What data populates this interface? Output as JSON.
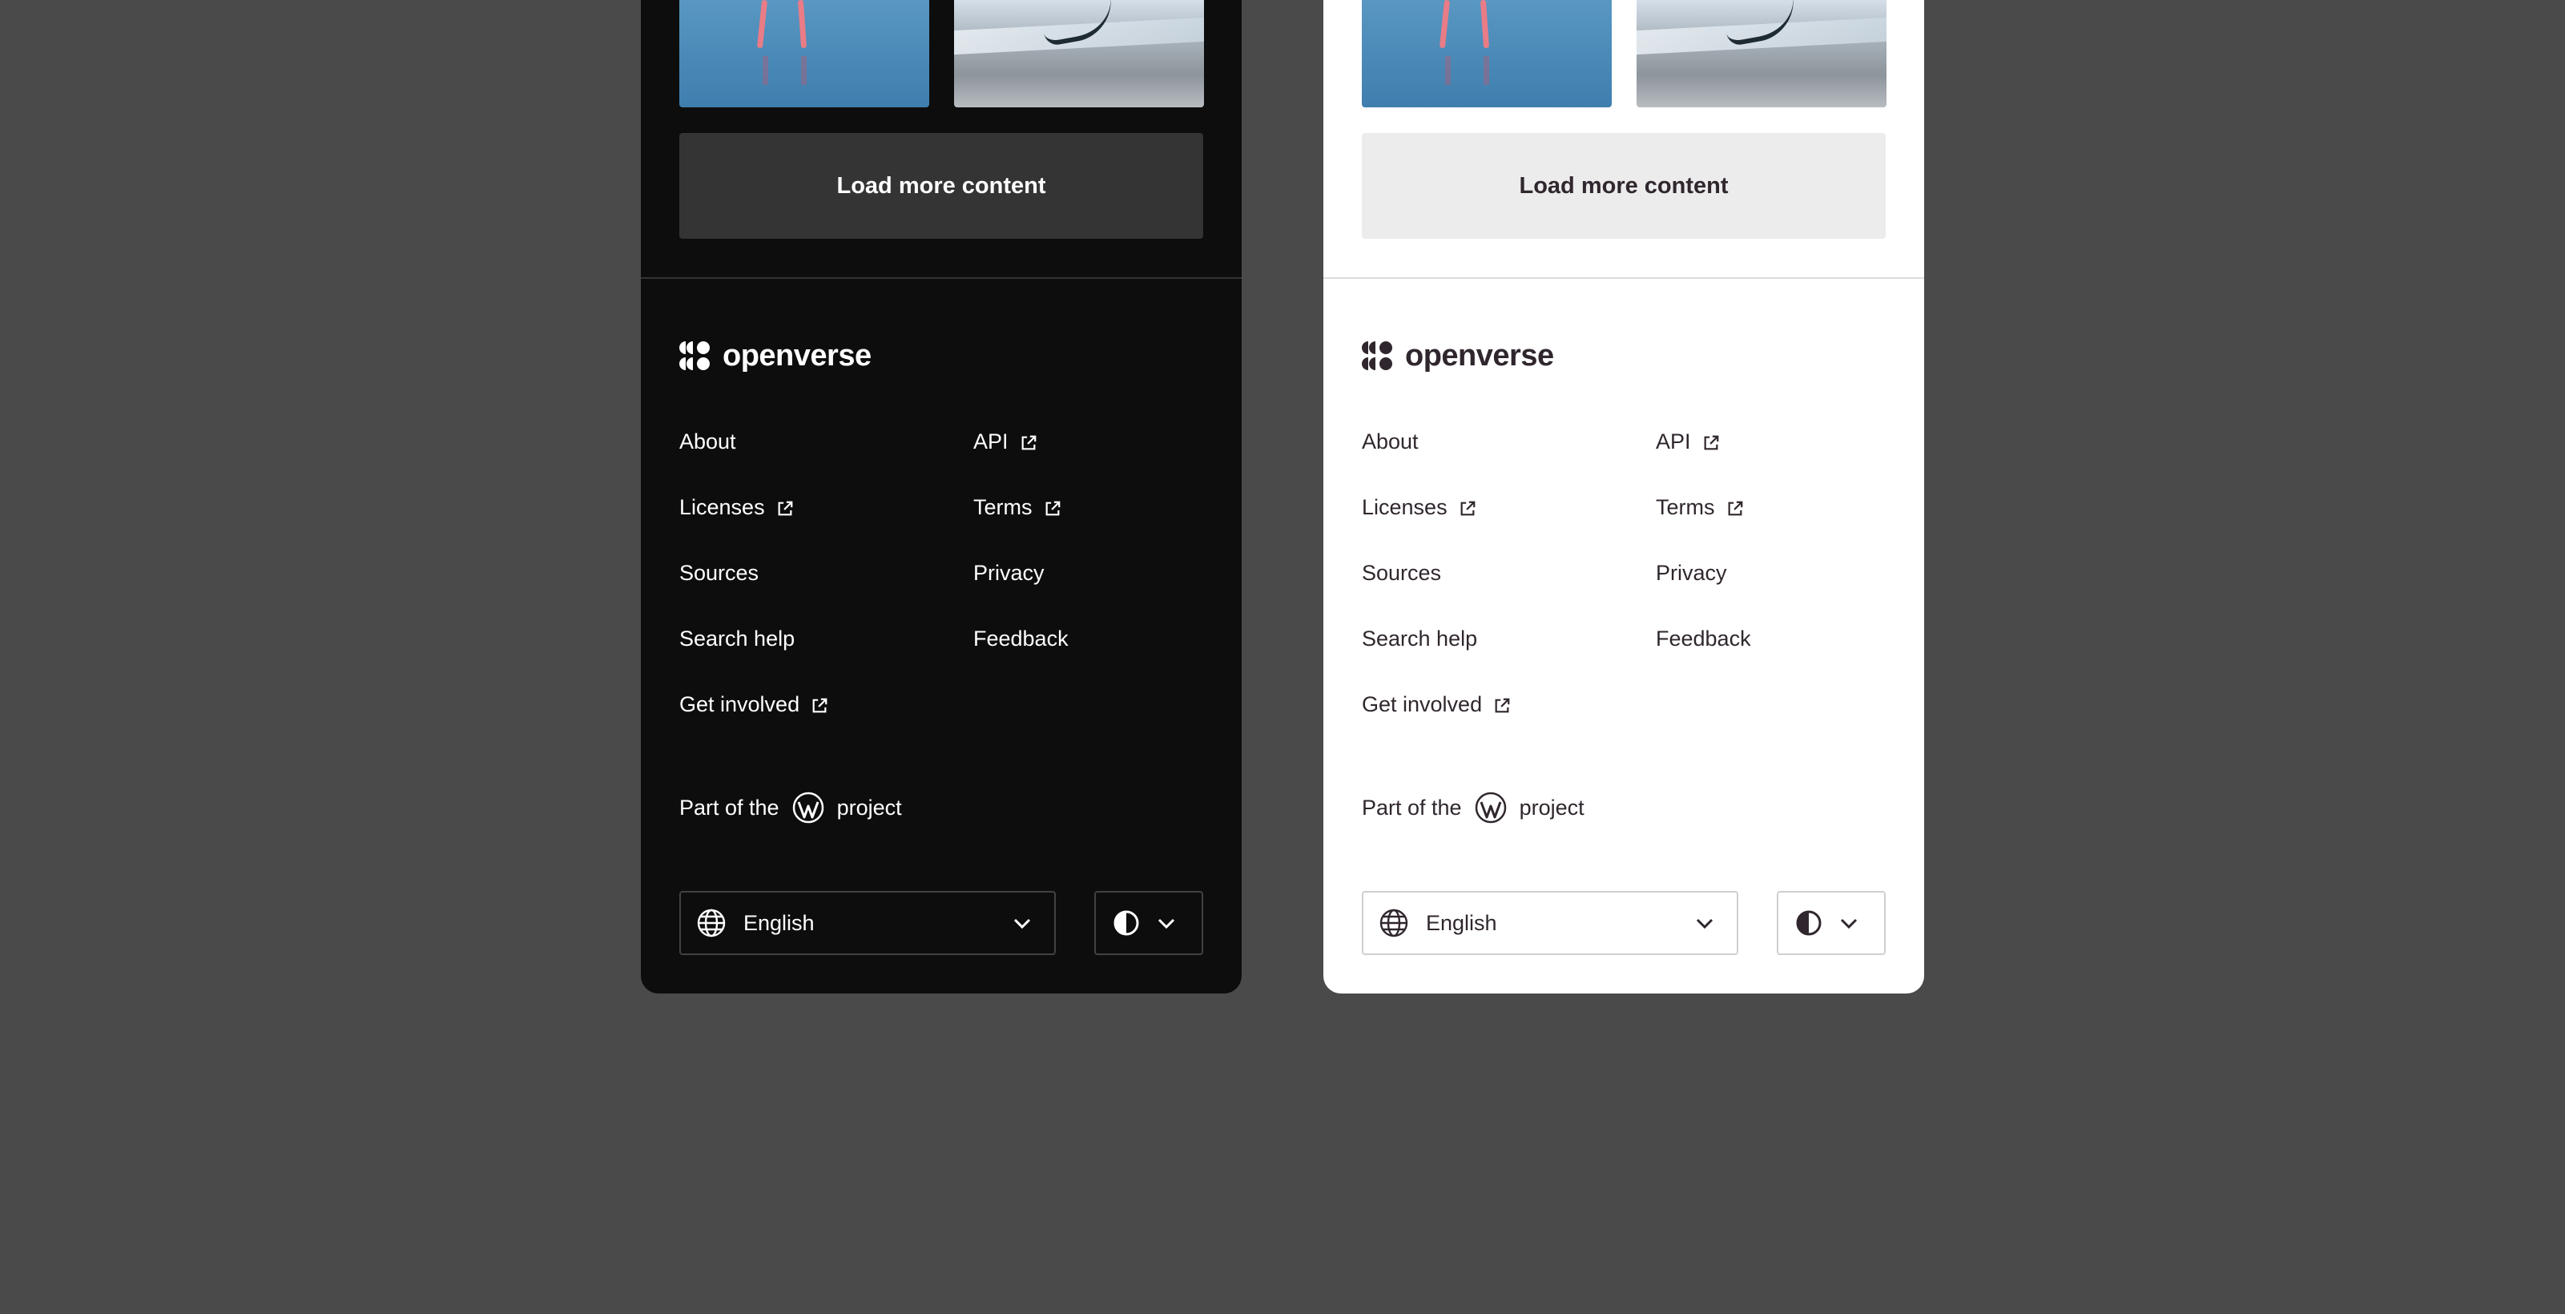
{
  "panels": [
    {
      "id": "dark",
      "load_more_label": "Load more content",
      "logo_text": "openverse",
      "nav_left": [
        "About",
        "Licenses",
        "Sources",
        "Search help",
        "Get involved"
      ],
      "nav_right": [
        "API",
        "Terms",
        "Privacy",
        "Feedback"
      ],
      "project_prefix": "Part of the",
      "project_suffix": "project",
      "language": "English"
    },
    {
      "id": "light",
      "load_more_label": "Load more content",
      "logo_text": "openverse",
      "nav_left": [
        "About",
        "Licenses",
        "Sources",
        "Search help",
        "Get involved"
      ],
      "nav_right": [
        "API",
        "Terms",
        "Privacy",
        "Feedback"
      ],
      "project_prefix": "Part of the",
      "project_suffix": "project",
      "language": "English"
    }
  ],
  "external_links": [
    "Licenses",
    "Get involved",
    "API",
    "Terms"
  ],
  "icons": {
    "logo": "openverse-logo-icon",
    "external": "external-link-icon",
    "wordpress": "wordpress-icon",
    "language": "globe-icon",
    "chevron": "chevron-down-icon",
    "theme": "contrast-icon"
  },
  "colors": {
    "page_background": "#4a4a4a",
    "dark_panel": "#0d0d0d",
    "light_panel": "#ffffff",
    "dark_button": "#343434",
    "light_button": "#ececec"
  }
}
